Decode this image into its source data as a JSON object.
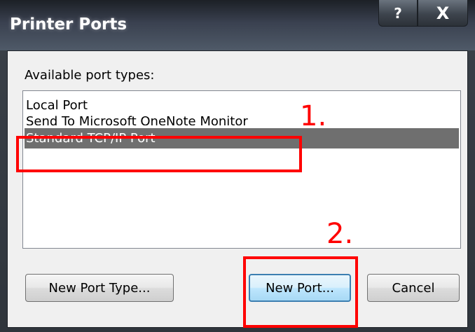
{
  "window": {
    "title": "Printer Ports",
    "help_glyph": "?",
    "close_glyph": "X"
  },
  "dialog": {
    "label": "Available port types:",
    "port_types": [
      "Local Port",
      "Send To Microsoft OneNote Monitor",
      "Standard TCP/IP Port"
    ],
    "selected_port_type": "Standard TCP/IP Port",
    "buttons": {
      "new_port_type": "New Port Type...",
      "new_port": "New Port...",
      "cancel": "Cancel"
    }
  },
  "annotations": {
    "step1": "1.",
    "step2": "2.",
    "color": "#ff0000"
  }
}
